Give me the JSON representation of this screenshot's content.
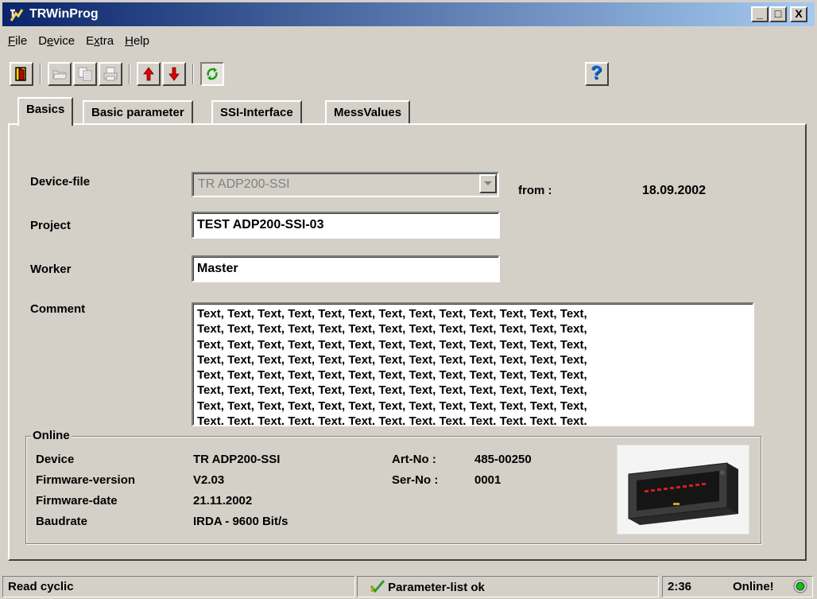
{
  "window": {
    "title": "TRWinProg",
    "controls": {
      "minimize": "_",
      "maximize": "□",
      "close": "X"
    }
  },
  "menu": [
    {
      "label": "File",
      "accel_index": 0
    },
    {
      "label": "Device",
      "accel_index": 1
    },
    {
      "label": "Extra",
      "accel_index": 1
    },
    {
      "label": "Help",
      "accel_index": 0
    }
  ],
  "toolbar": {
    "buttons": [
      "exit-icon",
      "open-folder-icon",
      "copy-icon",
      "print-icon",
      "upload-arrow-icon",
      "download-arrow-icon",
      "cyclic-refresh-icon",
      "help-icon"
    ],
    "help_label": "?"
  },
  "tabs": [
    {
      "label": "Basics",
      "active": true
    },
    {
      "label": "Basic parameter",
      "active": false
    },
    {
      "label": "SSI-Interface",
      "active": false
    },
    {
      "label": "MessValues",
      "active": false
    }
  ],
  "form": {
    "device_file_label": "Device-file",
    "device_file_value": "TR ADP200-SSI",
    "from_label": "from :",
    "from_value": "18.09.2002",
    "project_label": "Project",
    "project_value": "TEST ADP200-SSI-03",
    "worker_label": "Worker",
    "worker_value": "Master",
    "comment_label": "Comment",
    "comment_lines": [
      "Text, Text, Text, Text, Text, Text, Text, Text, Text, Text, Text, Text, Text,",
      "Text, Text, Text, Text, Text, Text, Text, Text, Text, Text, Text, Text, Text,",
      "Text, Text, Text, Text, Text, Text, Text, Text, Text, Text, Text, Text, Text,",
      "Text, Text, Text, Text, Text, Text, Text, Text, Text, Text, Text, Text, Text,",
      "Text, Text, Text, Text, Text, Text, Text, Text, Text, Text, Text, Text, Text,",
      "Text, Text, Text, Text, Text, Text, Text, Text, Text, Text, Text, Text, Text,",
      "Text, Text, Text, Text, Text, Text, Text, Text, Text, Text, Text, Text, Text,",
      "Text, Text, Text, Text, Text, Text, Text, Text, Text, Text, Text, Text, Text,"
    ]
  },
  "online": {
    "legend": "Online",
    "device_label": "Device",
    "device_value": "TR ADP200-SSI",
    "firmware_version_label": "Firmware-version",
    "firmware_version_value": "V2.03",
    "firmware_date_label": "Firmware-date",
    "firmware_date_value": "21.11.2002",
    "baudrate_label": "Baudrate",
    "baudrate_value": "IRDA - 9600 Bit/s",
    "art_no_label": "Art-No :",
    "art_no_value": "485-00250",
    "ser_no_label": "Ser-No :",
    "ser_no_value": "0001"
  },
  "status": {
    "mode": "Read cyclic",
    "parameter_state": "Parameter-list ok",
    "time": "2:36",
    "online_state": "Online!"
  },
  "colors": {
    "titlebar_start": "#0a246a",
    "titlebar_end": "#a6caf0",
    "face": "#d4d0c8",
    "ok_check": "#2e9e2e",
    "online_led": "#1fb51f"
  }
}
